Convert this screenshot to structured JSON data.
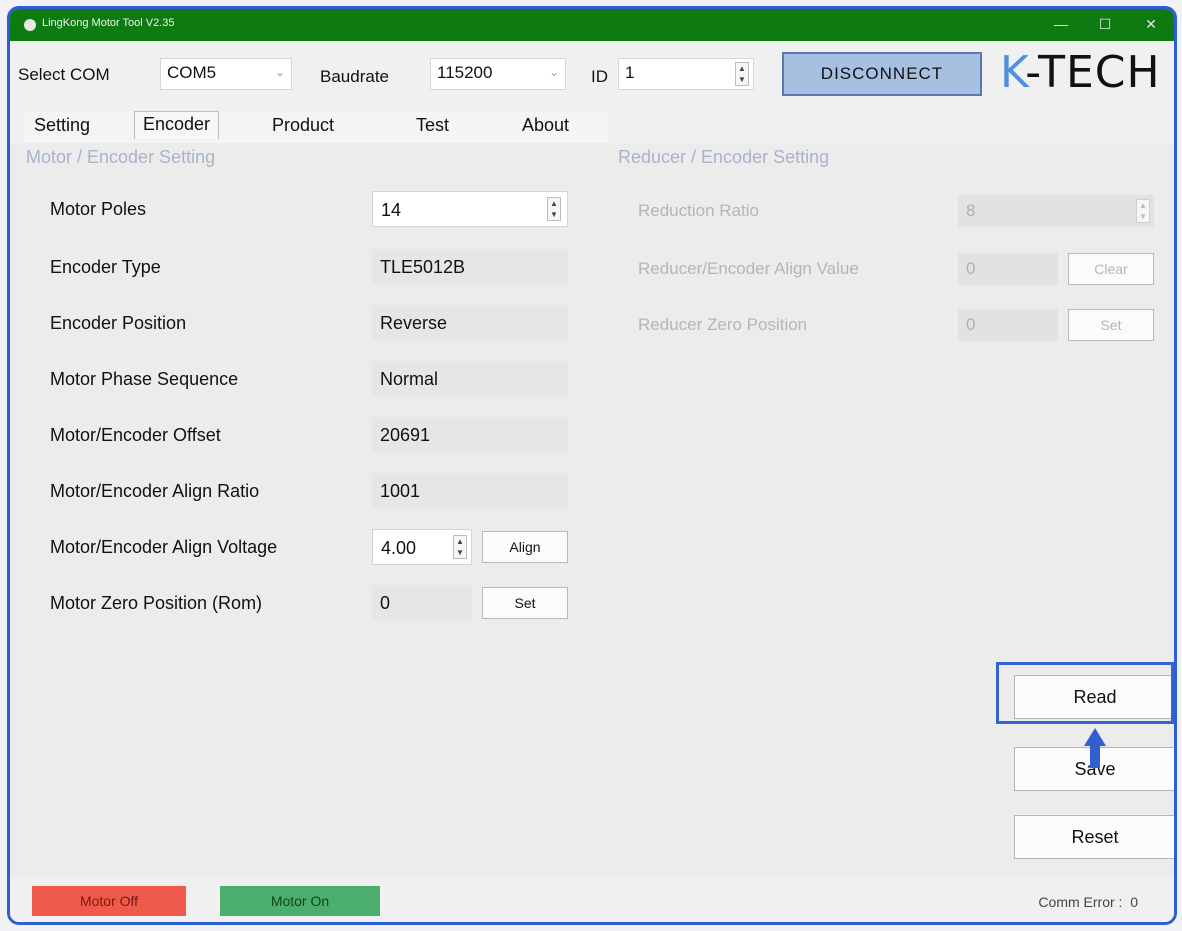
{
  "window": {
    "title": "LingKong Motor Tool V2.35"
  },
  "connection": {
    "select_com_label": "Select COM",
    "com_value": "COM5",
    "baudrate_label": "Baudrate",
    "baudrate_value": "115200",
    "id_label": "ID",
    "id_value": "1",
    "disconnect_label": "DISCONNECT",
    "logo_k": "K",
    "logo_rest": "-TECH"
  },
  "tabs": [
    {
      "label": "Setting"
    },
    {
      "label": "Encoder"
    },
    {
      "label": "Product"
    },
    {
      "label": "Test"
    },
    {
      "label": "About"
    }
  ],
  "motor_group": {
    "title": "Motor / Encoder Setting",
    "rows": [
      {
        "label": "Motor Poles",
        "value": "14"
      },
      {
        "label": "Encoder Type",
        "value": "TLE5012B"
      },
      {
        "label": "Encoder Position",
        "value": "Reverse"
      },
      {
        "label": "Motor Phase Sequence",
        "value": "Normal"
      },
      {
        "label": "Motor/Encoder Offset",
        "value": "20691"
      },
      {
        "label": "Motor/Encoder Align Ratio",
        "value": "1001"
      },
      {
        "label": "Motor/Encoder Align Voltage",
        "value": "4.00",
        "button": "Align"
      },
      {
        "label": "Motor Zero Position (Rom)",
        "value": "0",
        "button": "Set"
      }
    ]
  },
  "reducer_group": {
    "title": "Reducer / Encoder Setting",
    "rows": [
      {
        "label": "Reduction Ratio",
        "value": "8"
      },
      {
        "label": "Reducer/Encoder Align Value",
        "value": "0",
        "button": "Clear"
      },
      {
        "label": "Reducer Zero Position",
        "value": "0",
        "button": "Set"
      }
    ]
  },
  "actions": {
    "read": "Read",
    "save": "Save",
    "reset": "Reset"
  },
  "status": {
    "motor_off": "Motor Off",
    "motor_on": "Motor On",
    "comm_error_label": "Comm Error :",
    "comm_error_value": "0"
  },
  "colors": {
    "titlebar": "#0e7a12",
    "accent": "#2e5fd2",
    "motor_off": "#f05a4a",
    "motor_on": "#4cae6e"
  }
}
